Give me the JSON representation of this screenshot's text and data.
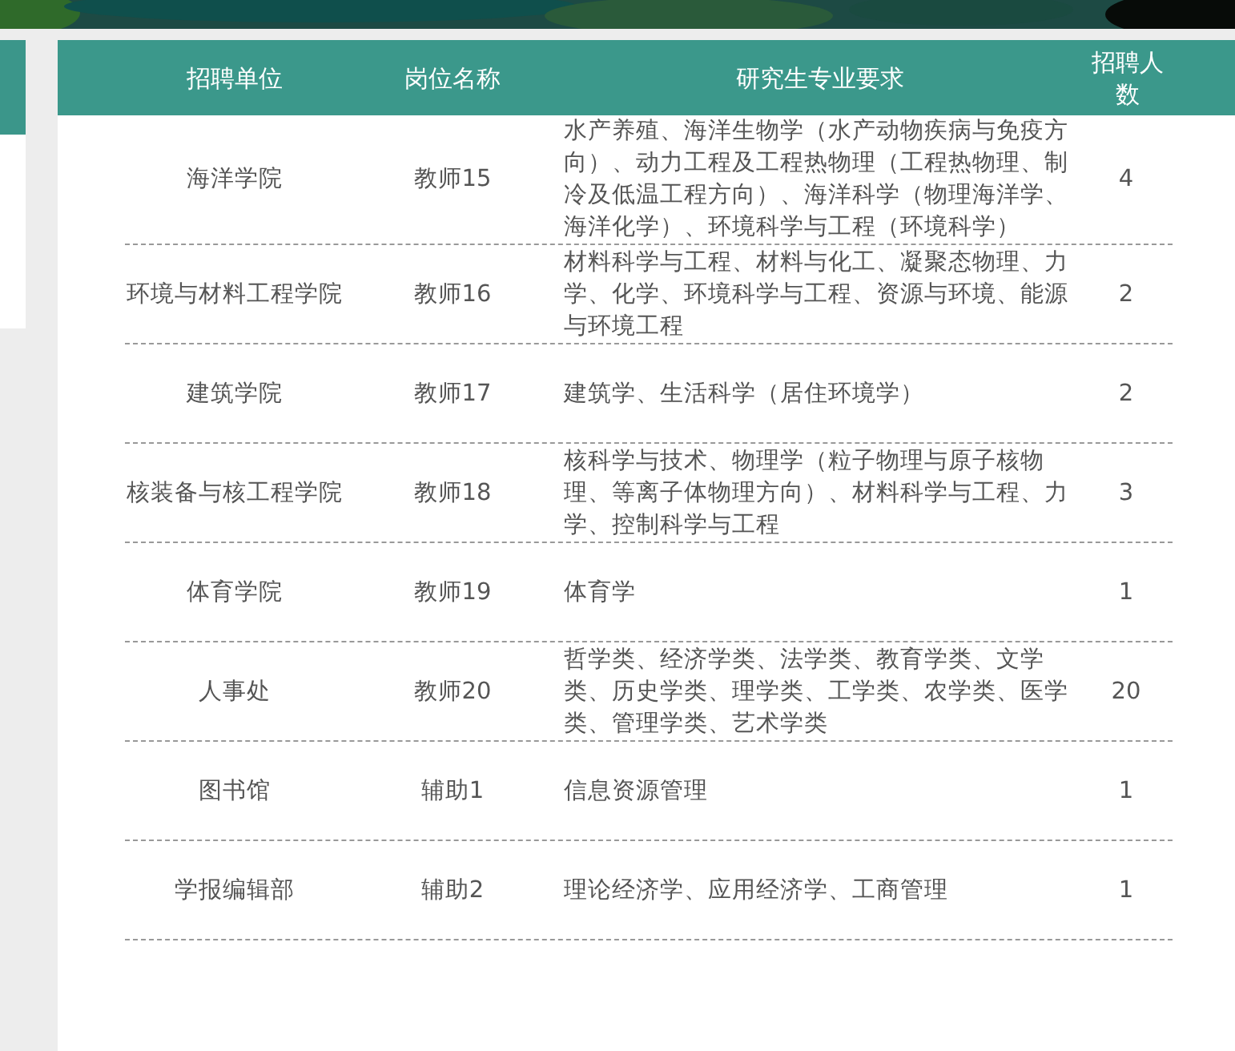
{
  "table": {
    "columns": [
      "招聘单位",
      "岗位名称",
      "研究生专业要求",
      "招聘人数"
    ],
    "rows": [
      {
        "unit": "海洋学院",
        "post": "教师15",
        "major": "水产养殖、海洋生物学（水产动物疾病与免疫方向）、动力工程及工程热物理（工程热物理、制冷及低温工程方向）、海洋科学（物理海洋学、海洋化学）、环境科学与工程（环境科学）",
        "count": "4"
      },
      {
        "unit": "环境与材料工程学院",
        "post": "教师16",
        "major": "材料科学与工程、材料与化工、凝聚态物理、力学、化学、环境科学与工程、资源与环境、能源与环境工程",
        "count": "2"
      },
      {
        "unit": "建筑学院",
        "post": "教师17",
        "major": "建筑学、生活科学（居住环境学）",
        "count": "2"
      },
      {
        "unit": "核装备与核工程学院",
        "post": "教师18",
        "major": "核科学与技术、物理学（粒子物理与原子核物理、等离子体物理方向）、材料科学与工程、力学、控制科学与工程",
        "count": "3"
      },
      {
        "unit": "体育学院",
        "post": "教师19",
        "major": "体育学",
        "count": "1"
      },
      {
        "unit": "人事处",
        "post": "教师20",
        "major": "哲学类、经济学类、法学类、教育学类、文学类、历史学类、理学类、工学类、农学类、医学类、管理学类、艺术学类",
        "count": "20"
      },
      {
        "unit": "图书馆",
        "post": "辅助1",
        "major": "信息资源管理",
        "count": "1"
      },
      {
        "unit": "学报编辑部",
        "post": "辅助2",
        "major": "理论经济学、应用经济学、工商管理",
        "count": "1"
      }
    ]
  }
}
